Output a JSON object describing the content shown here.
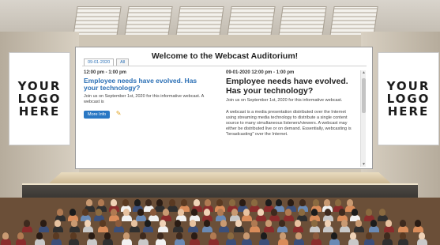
{
  "screen": {
    "title": "Welcome to the Webcast Auditorium!",
    "tabs": [
      {
        "label": "09-01-2020",
        "active": true
      },
      {
        "label": "All",
        "active": false
      }
    ]
  },
  "event_left": {
    "time": "12:00 pm - 1:00 pm",
    "title": "Employee needs have evolved. Has your technology?",
    "description": "Join us on September 1st, 2020 for this informative webcast. A webcast is",
    "more_info_label": "More Info"
  },
  "event_right": {
    "time": "09-01-2020  12:00 pm - 1:00 pm",
    "title": "Employee needs have evolved. Has your technology?",
    "description": "Join us on September 1st, 2020 for this informative webcast.",
    "body": "A webcast is a media presentation distributed over the Internet using streaming media technology to distribute a single content source to many simultaneous listeners/viewers. A webcast may either be distributed live or on demand. Essentially, webcasting is \"broadcasting\" over the Internet."
  },
  "logos": {
    "left": "YOUR\nLOGO\nHERE",
    "right": "YOUR\nLOGO\nHERE"
  },
  "icons": {
    "pencil": "pencil-icon",
    "scroll_up": "scroll-up-arrow-icon",
    "scroll_down": "scroll-down-arrow-icon"
  },
  "colors": {
    "link_blue": "#2a6fb5",
    "button_blue": "#2a78c4",
    "wood": "#c7b28c",
    "stage_dark": "#2b2926"
  }
}
